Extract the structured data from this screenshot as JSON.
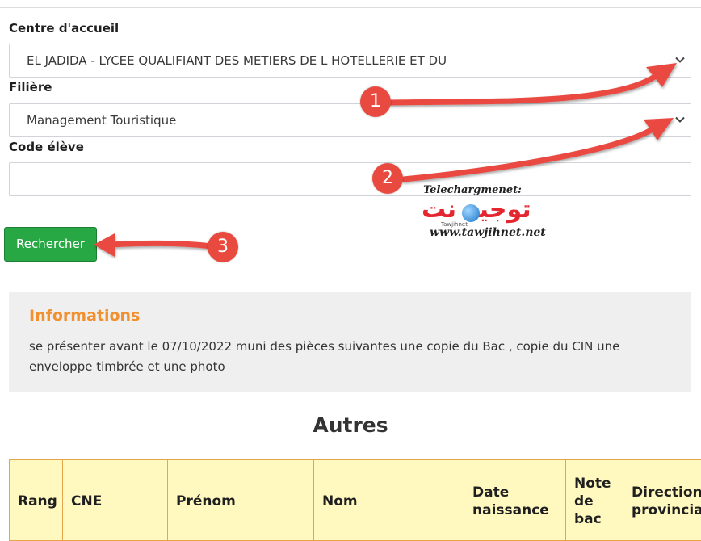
{
  "form": {
    "centre_label": "Centre d'accueil",
    "centre_value": "EL JADIDA - LYCEE QUALIFIANT DES METIERS DE L HOTELLERIE ET DU",
    "filiere_label": "Filière",
    "filiere_value": "Management Touristique",
    "code_label": "Code élève",
    "code_value": "",
    "search_button": "Rechercher"
  },
  "info": {
    "title": "Informations",
    "text": "se présenter avant le 07/10/2022 muni des pièces suivantes une copie du Bac , copie du CIN une enveloppe timbrée et une photo"
  },
  "results": {
    "title": "Autres",
    "columns": [
      "Rang",
      "CNE",
      "Prénom",
      "Nom",
      "Date naissance",
      "Note de bac",
      "Direction provinciale"
    ]
  },
  "annotations": {
    "badge_1": "1",
    "badge_2": "2",
    "badge_3": "3",
    "arrow_color": "#e94a40"
  },
  "watermark": {
    "prefix": "Telechargmenet:",
    "arabic": "توجيه نت",
    "small": "Tawjihnet",
    "url": "www.tawjihnet.net"
  },
  "colors": {
    "button": "#28a745",
    "info_title": "#f0902f",
    "table_header": "#fff9c0",
    "table_border": "#e6a44b"
  }
}
